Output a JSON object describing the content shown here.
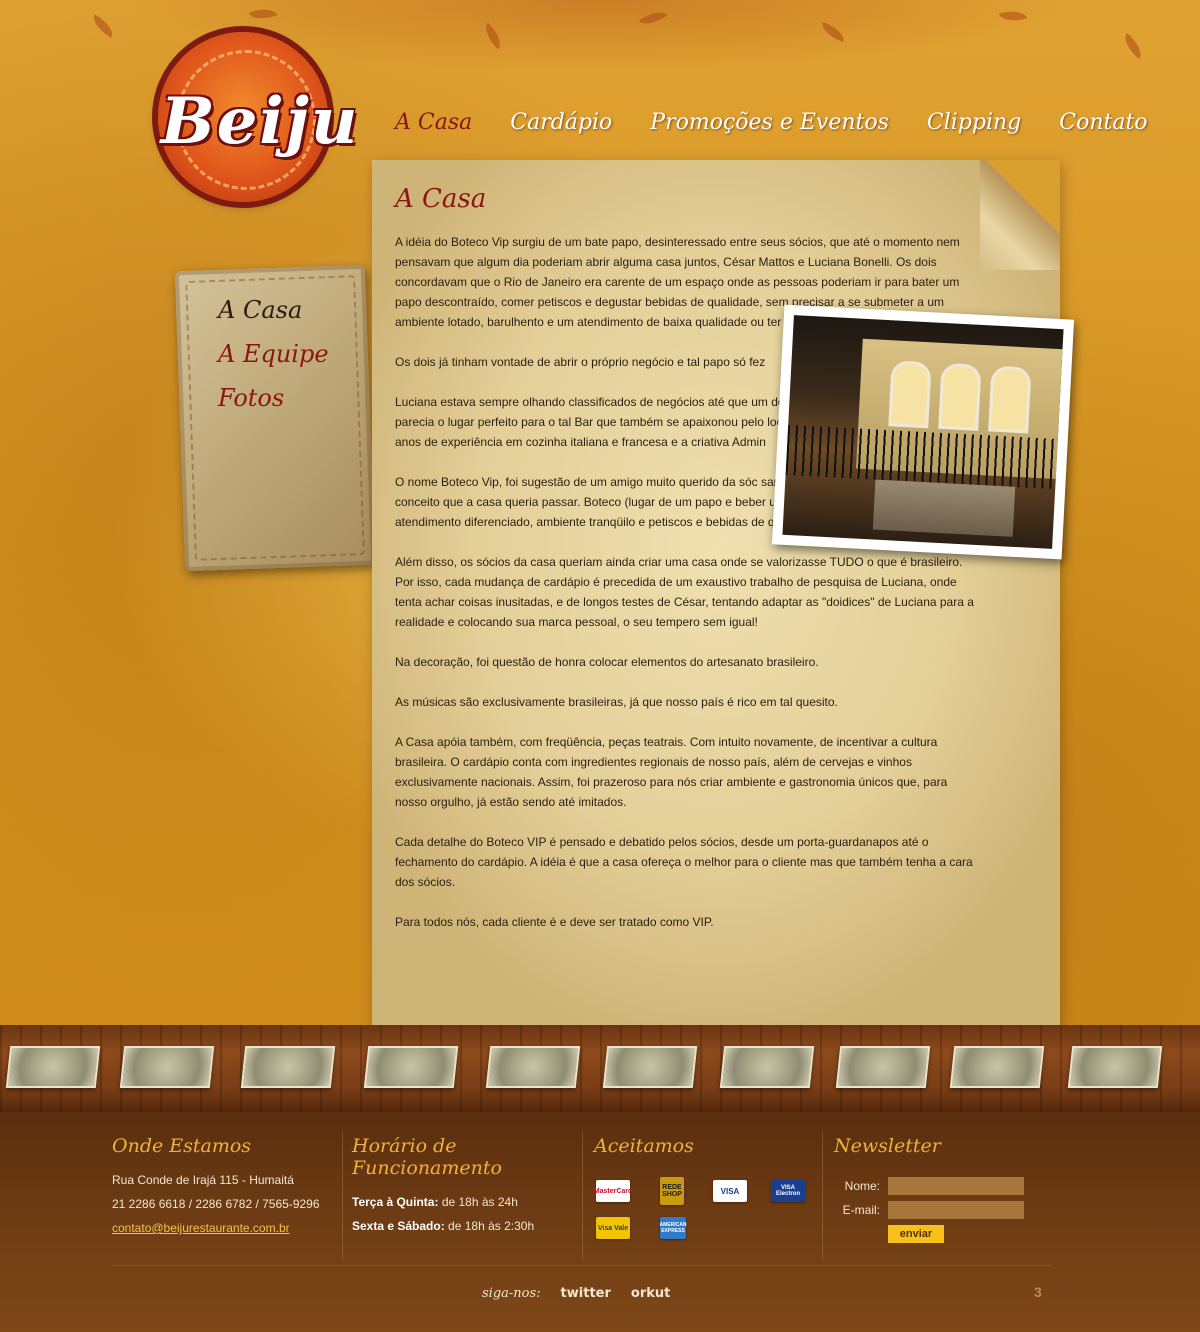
{
  "brand": {
    "logo_text": "Beiju"
  },
  "nav": {
    "items": [
      "A Casa",
      "Cardápio",
      "Promoções e Eventos",
      "Clipping",
      "Contato"
    ],
    "active": "A Casa"
  },
  "sidebar": {
    "items": [
      "A Casa",
      "A Equipe",
      "Fotos"
    ],
    "current": "A Casa"
  },
  "content": {
    "title": "A Casa",
    "paragraphs": [
      "A idéia do Boteco Vip surgiu de um bate papo, desinteressado entre seus sócios, que até o momento nem pensavam que algum dia poderiam abrir alguma casa juntos, César Mattos e Luciana Bonelli. Os dois concordavam que o Rio de Janeiro era carente de um espaço onde as pessoas poderiam ir para bater um papo descontraído, comer petiscos e degustar bebidas de qualidade, sem precisar a se submeter a um ambiente lotado, barulhento e um atendimento de baixa qualidade ou ter que recorrer a um restaurante.",
      "Os dois já tinham vontade de abrir o próprio negócio e tal papo só fez",
      "Luciana estava sempre olhando classificados de negócios até que um de um casarão em Botafogo. Ali parecia o lugar perfeito para o tal Bar que também se apaixonou pelo local. Surgiu aí a sociedade entre o e anos de experiência em cozinha italiana e francesa e a criativa Admin",
      "O nome Boteco Vip, foi sugestão de um amigo muito querido da sóc sante, pois refletia exatamente o conceito que a casa queria passar. Boteco (lugar de um papo e beber uma cerveja) e VIP (com um atendimento diferenciado, ambiente tranqüilo e petiscos e bebidas de qualidade).",
      "Além disso, os sócios da casa queriam ainda criar uma casa onde se valorizasse TUDO o que é brasileiro. Por isso, cada mudança de cardápio é precedida de um exaustivo trabalho de pesquisa de Luciana, onde tenta achar coisas inusitadas, e de longos testes de César, tentando adaptar as \"doidices\" de Luciana para a realidade e colocando sua marca pessoal, o seu tempero sem igual!",
      "Na decoração, foi questão de honra colocar elementos do artesanato brasileiro.",
      "As músicas são exclusivamente brasileiras, já que nosso país é rico em tal quesito.",
      "A Casa apóia também, com freqüência, peças teatrais. Com intuito novamente, de incentivar a cultura brasileira. O cardápio conta com ingredientes regionais de nosso país, além de cervejas e vinhos exclusivamente nacionais. Assim, foi prazeroso para nós criar ambiente e gastronomia únicos que, para nosso orgulho, já estão sendo até imitados.",
      "Cada detalhe do Boteco VIP é pensado e debatido pelos sócios, desde um porta-guardanapos até o fechamento do cardápio. A idéia é que a casa ofereça o melhor para o cliente mas que também tenha a cara dos sócios.",
      "Para todos nós, cada cliente é e deve ser tratado como VIP."
    ]
  },
  "footer": {
    "location": {
      "title": "Onde Estamos",
      "address": "Rua Conde de Irajá 115 - Humaitá",
      "phones": "21 2286 6618 / 2286 6782 / 7565-9296",
      "email": "contato@beijurestaurante.com.br"
    },
    "hours": {
      "title": "Horário de Funcionamento",
      "rows": [
        {
          "days": "Terça à Quinta:",
          "time": "de 18h às 24h"
        },
        {
          "days": "Sexta e Sábado:",
          "time": "de 18h às 2:30h"
        }
      ]
    },
    "payment": {
      "title": "Aceitamos",
      "cards": [
        "MasterCard",
        "REDE SHOP",
        "VISA",
        "VISA Electron",
        "Visa Vale",
        "AMERICAN EXPRESS"
      ]
    },
    "newsletter": {
      "title": "Newsletter",
      "name_label": "Nome:",
      "email_label": "E-mail:",
      "button": "enviar"
    },
    "social": {
      "label": "siga-nos:",
      "links": [
        "twitter",
        "orkut"
      ]
    },
    "page_number": "3"
  },
  "colors": {
    "accent": "#8a1612",
    "footer_bg": "#5a2e0d",
    "footer_title": "#f0b23a",
    "button": "#f6c21a"
  }
}
